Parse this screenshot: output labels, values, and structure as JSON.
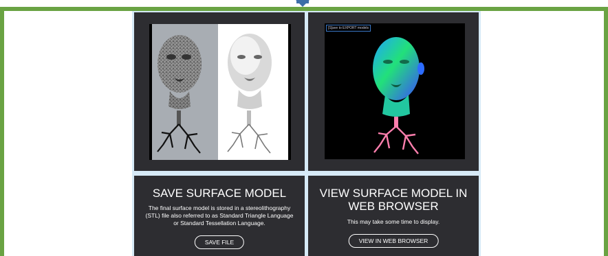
{
  "cards": [
    {
      "title": "SAVE SURFACE MODEL",
      "description": "The final surface model is stored in a stereolithography (STL) file also referred to as Standard Triangle Language or Standard Tessellation Language.",
      "button_label": "SAVE FILE"
    },
    {
      "title": "VIEW SURFACE MODEL IN WEB BROWSER",
      "description": "This may take some time to display.",
      "button_label": "VIEW IN WEB BROWSER"
    }
  ],
  "preview": {
    "export_label": "[S]ave to EXPORT models"
  },
  "colors": {
    "frame": "#6aa343",
    "card_bg": "#2d2d31",
    "grid_bg": "#d6eaf7",
    "marker": "#3d6ea8"
  }
}
